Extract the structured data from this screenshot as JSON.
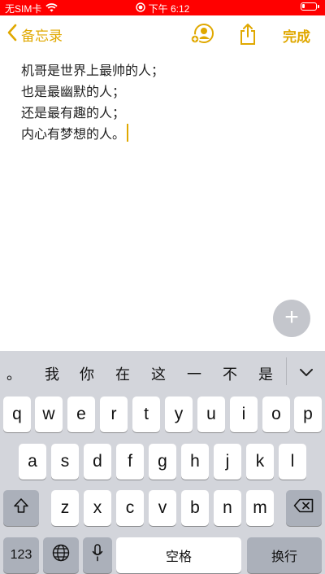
{
  "status_bar": {
    "carrier": "无SIM卡",
    "time": "下午 6:12",
    "battery_level": 0.2,
    "background": "#ff0000"
  },
  "nav": {
    "back_label": "备忘录",
    "done_label": "完成",
    "accent": "#e0a800"
  },
  "note": {
    "lines": [
      "机哥是世界上最帅的人；",
      "也是最幽默的人；",
      "还是最有趣的人；",
      "内心有梦想的人。"
    ]
  },
  "add_button": {
    "label": "+"
  },
  "keyboard": {
    "candidates": [
      "。",
      "我",
      "你",
      "在",
      "这",
      "一",
      "不",
      "是"
    ],
    "row1": [
      "q",
      "w",
      "e",
      "r",
      "t",
      "y",
      "u",
      "i",
      "o",
      "p"
    ],
    "row2": [
      "a",
      "s",
      "d",
      "f",
      "g",
      "h",
      "j",
      "k",
      "l"
    ],
    "row3": [
      "z",
      "x",
      "c",
      "v",
      "b",
      "n",
      "m"
    ],
    "numbers_label": "123",
    "space_label": "空格",
    "return_label": "换行"
  }
}
